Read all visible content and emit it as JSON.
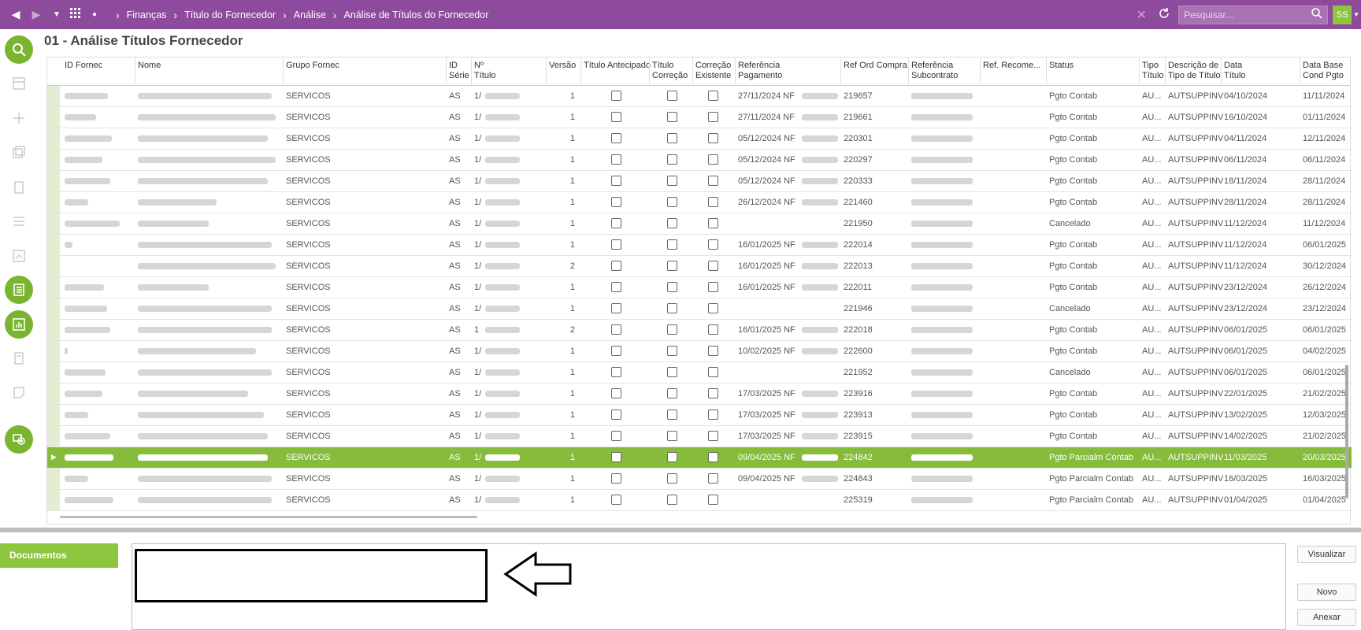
{
  "topbar": {
    "breadcrumbs": [
      "Finanças",
      "Título do Fornecedor",
      "Análise",
      "Análise de Títulos do Fornecedor"
    ],
    "search_placeholder": "Pesquisar...",
    "user_initials": "SS",
    "color": "#8e4a9c"
  },
  "page": {
    "title": "01 - Análise Títulos Fornecedor"
  },
  "grid": {
    "columns": [
      {
        "label": "ID Fornec"
      },
      {
        "label": "Nome"
      },
      {
        "label": "Grupo Fornec"
      },
      {
        "label": "ID\nSérie"
      },
      {
        "label": "Nº\nTítulo"
      },
      {
        "label": "Versão"
      },
      {
        "label": "Título Antecipado"
      },
      {
        "label": "Título\nCorreção"
      },
      {
        "label": "Correção\nExistente"
      },
      {
        "label": "Referência\nPagamento"
      },
      {
        "label": "Ref Ord Compra"
      },
      {
        "label": "Referência\nSubcontrato"
      },
      {
        "label": "Ref. Recome..."
      },
      {
        "label": "Status"
      },
      {
        "label": "Tipo\nTítulo"
      },
      {
        "label": "Descrição de\nTipo de Título"
      },
      {
        "label": "Data\nTítulo"
      },
      {
        "label": "Data Base\nCond Pgto"
      }
    ],
    "rows": [
      {
        "grupo": "SERVICOS",
        "serie": "AS",
        "titulo": "1/",
        "versao": "1",
        "ref_pag": "27/11/2024 NF",
        "ref_oc": "219657",
        "status": "Pgto Contab",
        "tipo": "AU...",
        "desc": "AUTSUPPINV",
        "data": "04/10/2024",
        "base": "11/11/2024"
      },
      {
        "grupo": "SERVICOS",
        "serie": "AS",
        "titulo": "1/",
        "versao": "1",
        "ref_pag": "27/11/2024 NF",
        "ref_oc": "219661",
        "status": "Pgto Contab",
        "tipo": "AU...",
        "desc": "AUTSUPPINV",
        "data": "16/10/2024",
        "base": "01/11/2024"
      },
      {
        "grupo": "SERVICOS",
        "serie": "AS",
        "titulo": "1/",
        "versao": "1",
        "ref_pag": "05/12/2024 NF",
        "ref_oc": "220301",
        "status": "Pgto Contab",
        "tipo": "AU...",
        "desc": "AUTSUPPINV",
        "data": "04/11/2024",
        "base": "12/11/2024"
      },
      {
        "grupo": "SERVICOS",
        "serie": "AS",
        "titulo": "1/",
        "versao": "1",
        "ref_pag": "05/12/2024 NF",
        "ref_oc": "220297",
        "status": "Pgto Contab",
        "tipo": "AU...",
        "desc": "AUTSUPPINV",
        "data": "06/11/2024",
        "base": "06/11/2024"
      },
      {
        "grupo": "SERVICOS",
        "serie": "AS",
        "titulo": "1/",
        "versao": "1",
        "ref_pag": "05/12/2024 NF",
        "ref_oc": "220333",
        "status": "Pgto Contab",
        "tipo": "AU...",
        "desc": "AUTSUPPINV",
        "data": "18/11/2024",
        "base": "28/11/2024"
      },
      {
        "grupo": "SERVICOS",
        "serie": "AS",
        "titulo": "1/",
        "versao": "1",
        "ref_pag": "26/12/2024 NF",
        "ref_oc": "221460",
        "status": "Pgto Contab",
        "tipo": "AU...",
        "desc": "AUTSUPPINV",
        "data": "28/11/2024",
        "base": "28/11/2024"
      },
      {
        "grupo": "SERVICOS",
        "serie": "AS",
        "titulo": "1/",
        "versao": "1",
        "ref_pag": "",
        "ref_oc": "221950",
        "status": "Cancelado",
        "tipo": "AU...",
        "desc": "AUTSUPPINV",
        "data": "11/12/2024",
        "base": "11/12/2024"
      },
      {
        "grupo": "SERVICOS",
        "serie": "AS",
        "titulo": "1/",
        "versao": "1",
        "ref_pag": "16/01/2025 NF",
        "ref_oc": "222014",
        "status": "Pgto Contab",
        "tipo": "AU...",
        "desc": "AUTSUPPINV",
        "data": "11/12/2024",
        "base": "06/01/2025"
      },
      {
        "grupo": "SERVICOS",
        "serie": "AS",
        "titulo": "1/",
        "versao": "2",
        "ref_pag": "16/01/2025 NF",
        "ref_oc": "222013",
        "status": "Pgto Contab",
        "tipo": "AU...",
        "desc": "AUTSUPPINV",
        "data": "11/12/2024",
        "base": "30/12/2024"
      },
      {
        "grupo": "SERVICOS",
        "serie": "AS",
        "titulo": "1/",
        "versao": "1",
        "ref_pag": "16/01/2025 NF",
        "ref_oc": "222011",
        "status": "Pgto Contab",
        "tipo": "AU...",
        "desc": "AUTSUPPINV",
        "data": "23/12/2024",
        "base": "26/12/2024"
      },
      {
        "grupo": "SERVICOS",
        "serie": "AS",
        "titulo": "1/",
        "versao": "1",
        "ref_pag": "",
        "ref_oc": "221946",
        "status": "Cancelado",
        "tipo": "AU...",
        "desc": "AUTSUPPINV",
        "data": "23/12/2024",
        "base": "23/12/2024"
      },
      {
        "grupo": "SERVICOS",
        "serie": "AS",
        "titulo": "1",
        "versao": "2",
        "ref_pag": "16/01/2025 NF",
        "ref_oc": "222018",
        "status": "Pgto Contab",
        "tipo": "AU...",
        "desc": "AUTSUPPINV",
        "data": "06/01/2025",
        "base": "06/01/2025"
      },
      {
        "grupo": "SERVICOS",
        "serie": "AS",
        "titulo": "1/",
        "versao": "1",
        "ref_pag": "10/02/2025 NF",
        "ref_oc": "222600",
        "status": "Pgto Contab",
        "tipo": "AU...",
        "desc": "AUTSUPPINV",
        "data": "06/01/2025",
        "base": "04/02/2025"
      },
      {
        "grupo": "SERVICOS",
        "serie": "AS",
        "titulo": "1/",
        "versao": "1",
        "ref_pag": "",
        "ref_oc": "221952",
        "status": "Cancelado",
        "tipo": "AU...",
        "desc": "AUTSUPPINV",
        "data": "06/01/2025",
        "base": "06/01/2025"
      },
      {
        "grupo": "SERVICOS",
        "serie": "AS",
        "titulo": "1/",
        "versao": "1",
        "ref_pag": "17/03/2025 NF",
        "ref_oc": "223916",
        "status": "Pgto Contab",
        "tipo": "AU...",
        "desc": "AUTSUPPINV",
        "data": "22/01/2025",
        "base": "21/02/2025"
      },
      {
        "grupo": "SERVICOS",
        "serie": "AS",
        "titulo": "1/",
        "versao": "1",
        "ref_pag": "17/03/2025 NF",
        "ref_oc": "223913",
        "status": "Pgto Contab",
        "tipo": "AU...",
        "desc": "AUTSUPPINV",
        "data": "13/02/2025",
        "base": "12/03/2025"
      },
      {
        "grupo": "SERVICOS",
        "serie": "AS",
        "titulo": "1/",
        "versao": "1",
        "ref_pag": "17/03/2025 NF",
        "ref_oc": "223915",
        "status": "Pgto Contab",
        "tipo": "AU...",
        "desc": "AUTSUPPINV",
        "data": "14/02/2025",
        "base": "21/02/2025"
      },
      {
        "grupo": "SERVICOS",
        "serie": "AS",
        "titulo": "1/",
        "versao": "1",
        "ref_pag": "09/04/2025 NF",
        "ref_oc": "224842",
        "status": "Pgto Parcialm Contab",
        "tipo": "AU...",
        "desc": "AUTSUPPINV",
        "data": "11/03/2025",
        "base": "20/03/2025",
        "selected": true
      },
      {
        "grupo": "SERVICOS",
        "serie": "AS",
        "titulo": "1/",
        "versao": "1",
        "ref_pag": "09/04/2025 NF",
        "ref_oc": "224843",
        "status": "Pgto Parcialm Contab",
        "tipo": "AU...",
        "desc": "AUTSUPPINV",
        "data": "16/03/2025",
        "base": "16/03/2025"
      },
      {
        "grupo": "SERVICOS",
        "serie": "AS",
        "titulo": "1/",
        "versao": "1",
        "ref_pag": "",
        "ref_oc": "225319",
        "status": "Pgto Parcialm Contab",
        "tipo": "AU...",
        "desc": "AUTSUPPINV",
        "data": "01/04/2025",
        "base": "01/04/2025"
      }
    ]
  },
  "documents": {
    "tab_label": "Documentos",
    "buttons": {
      "view": "Visualizar",
      "new": "Novo",
      "attach": "Anexar"
    }
  },
  "colors": {
    "accent_green": "#8cc63f",
    "selected_row": "#86bb3c",
    "topbar": "#8e4a9c"
  }
}
